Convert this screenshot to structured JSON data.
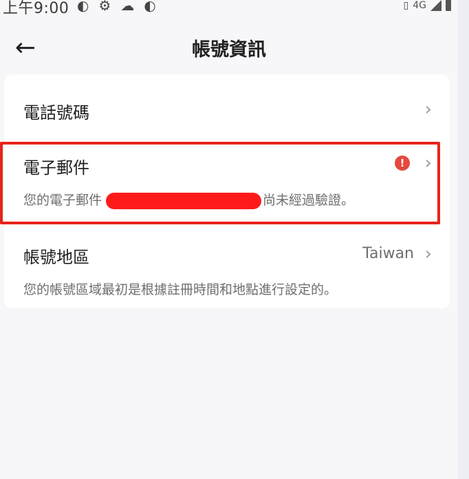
{
  "status_bar": {
    "time": "上午9:00",
    "network": "4G",
    "left_icons": [
      "notification-icon",
      "gear-icon",
      "cloud-icon",
      "notification-icon"
    ]
  },
  "header": {
    "title": "帳號資訊",
    "back_icon": "arrow-left-icon"
  },
  "account": {
    "phone": {
      "label": "電話號碼"
    },
    "email": {
      "label": "電子郵件",
      "sub_prefix": "您的電子郵件",
      "sub_suffix": "尚未經過驗證。",
      "alert_glyph": "!"
    },
    "region": {
      "label": "帳號地區",
      "value": "Taiwan",
      "sub": "您的帳號區域最初是根據註冊時間和地點進行設定的。"
    }
  },
  "colors": {
    "alert": "#e5483c",
    "highlight": "#e8231a",
    "redaction": "#ff1a1a"
  }
}
